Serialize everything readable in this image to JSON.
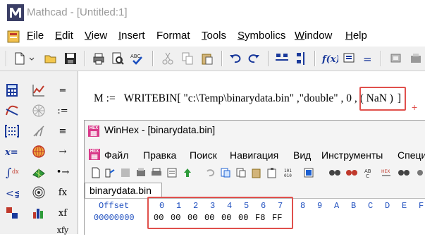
{
  "mathcad": {
    "title": "Mathcad - [Untitled:1]",
    "menu": [
      {
        "label": "File",
        "ul": "F",
        "rest": "ile"
      },
      {
        "label": "Edit",
        "ul": "E",
        "rest": "dit"
      },
      {
        "label": "View",
        "ul": "V",
        "rest": "iew"
      },
      {
        "label": "Insert",
        "ul": "I",
        "rest": "nsert"
      },
      {
        "label": "Format",
        "ul": "",
        "rest": "Format"
      },
      {
        "label": "Tools",
        "ul": "T",
        "rest": "ools"
      },
      {
        "label": "Symbolics",
        "ul": "S",
        "rest": "ymbolics"
      },
      {
        "label": "Window",
        "ul": "W",
        "rest": "indow"
      },
      {
        "label": "Help",
        "ul": "H",
        "rest": "elp"
      }
    ],
    "palette_labels": [
      "=",
      ":=",
      "≡",
      "→",
      "•→",
      "fx",
      "xf",
      "xfy"
    ],
    "formula": {
      "lhs": "M :=",
      "func": "WRITEBIN",
      "args": "[ \"c:\\Temp\\binarydata.bin\" ,\"double\" , 0 ,",
      "nan": "( NaN )",
      "close": "]"
    },
    "plus_marker": "+"
  },
  "winhex": {
    "title": "WinHex - [binarydata.bin]",
    "logo_text": "HEX",
    "menu": [
      "Файл",
      "Правка",
      "Поиск",
      "Навигация",
      "Вид",
      "Инструменты",
      "Специ"
    ],
    "tab": "binarydata.bin",
    "hex_header": {
      "offset_label": "Offset",
      "columns": [
        "0",
        "1",
        "2",
        "3",
        "4",
        "5",
        "6",
        "7",
        "8",
        "9",
        "A",
        "B",
        "C",
        "D",
        "E",
        "F"
      ]
    },
    "rows": [
      {
        "offset": "00000000",
        "bytes": [
          "00",
          "00",
          "00",
          "00",
          "00",
          "00",
          "F8",
          "FF"
        ]
      }
    ]
  },
  "colors": {
    "highlight": "#e0504c",
    "hex_header": "#1f4fbf"
  }
}
